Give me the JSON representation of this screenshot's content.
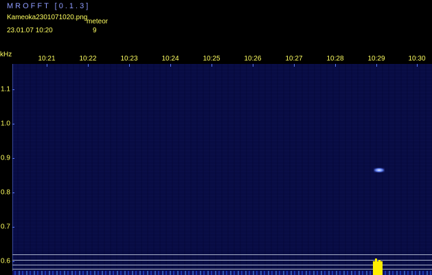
{
  "header": {
    "app_title": "MROFFT [0.1.3]",
    "file_name": "Kameoka2301071020.png",
    "event_label": "meteor",
    "date_time": "23.01.07 10:20",
    "event_count": "9"
  },
  "axes": {
    "y_unit": "kHz",
    "time_labels": [
      "10:21",
      "10:22",
      "10:23",
      "10:24",
      "10:25",
      "10:26",
      "10:27",
      "10:28",
      "10:29",
      "10:30"
    ],
    "freq_labels": [
      "1.1",
      "1.0",
      "0.9",
      "0.8",
      "0.7",
      "0.6"
    ]
  },
  "colors": {
    "label": "#ffff60",
    "title": "#8f9cff",
    "background": "#080c44",
    "echo": "#6a8cff",
    "carrier": "#ffee00"
  }
}
